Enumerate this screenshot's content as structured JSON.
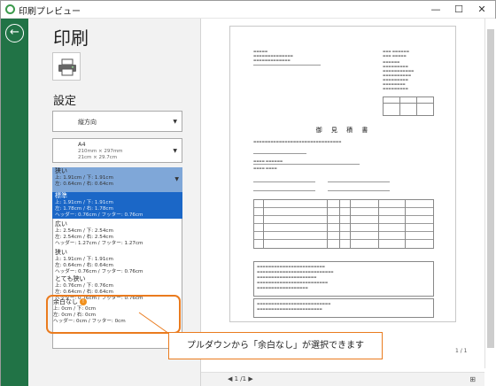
{
  "window": {
    "title": "印刷プレビュー",
    "minimize": "—",
    "maximize": "☐",
    "close": "✕"
  },
  "panel": {
    "title": "印刷",
    "settings_label": "設定",
    "orientation": "縦方向",
    "paper": {
      "name": "A4",
      "line1": "210mm × 297mm",
      "line2": "21cm × 29.7cm"
    }
  },
  "margin_options": [
    {
      "name": "狭い",
      "lines": [
        "上: 1.91cm / 下: 1.91cm",
        "左: 0.64cm / 右: 0.64cm",
        "ヘッダー: 0.76cm / フッター: 0.76cm"
      ],
      "state": "selected"
    },
    {
      "name": "標準",
      "lines": [
        "上: 1.91cm / 下: 1.91cm",
        "左: 1.78cm / 右: 1.78cm",
        "ヘッダー: 0.76cm / フッター: 0.76cm"
      ],
      "state": "highlighted"
    },
    {
      "name": "広い",
      "lines": [
        "上: 2.54cm / 下: 2.54cm",
        "左: 2.54cm / 右: 2.54cm",
        "ヘッダー: 1.27cm / フッター: 1.27cm"
      ],
      "state": ""
    },
    {
      "name": "狭い",
      "lines": [
        "上: 1.91cm / 下: 1.91cm",
        "左: 0.64cm / 右: 0.64cm",
        "ヘッダー: 0.76cm / フッター: 0.76cm"
      ],
      "state": ""
    },
    {
      "name": "とても狭い",
      "lines": [
        "上: 0.76cm / 下: 0.76cm",
        "左: 0.64cm / 右: 0.64cm",
        "ヘッダー: 0.76cm / フッター: 0.76cm"
      ],
      "state": ""
    }
  ],
  "no_margin_option": {
    "name": "余白なし",
    "badge": "!",
    "lines": [
      "上: 0cm / 下: 0cm",
      "左: 0cm / 右: 0cm",
      "ヘッダー: 0cm / フッター: 0cm"
    ]
  },
  "callout": "プルダウンから「余白なし」が選択できます",
  "preview": {
    "doc_title": "御 見 積 書",
    "page_indicator": "1 / 1",
    "pager": "◀  1  /1  ▶"
  },
  "colors": {
    "excel_green": "#217346",
    "highlight_orange": "#ea7b1e",
    "selection_blue": "#1b67c7"
  }
}
